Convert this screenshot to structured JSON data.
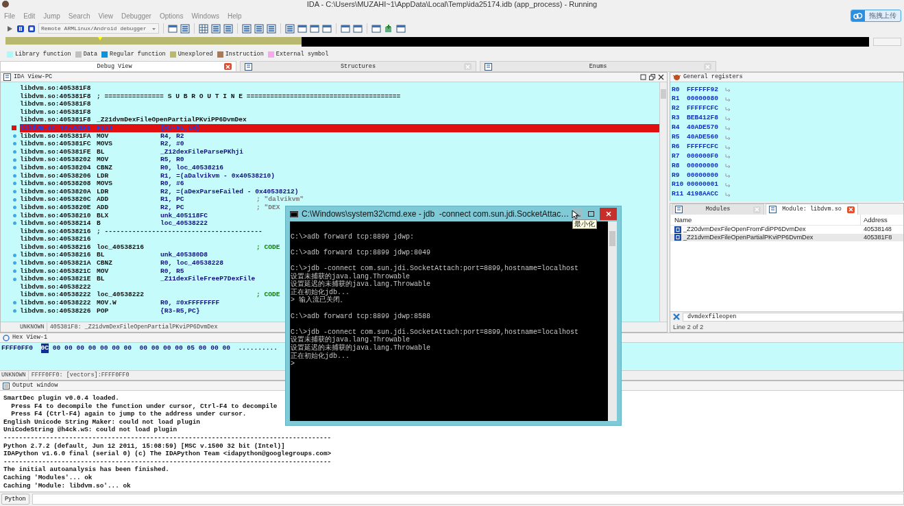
{
  "window": {
    "title": "IDA - C:\\Users\\MUZAHI~1\\AppData\\Local\\Temp\\ida25174.idb (app_process) - Running"
  },
  "menu": [
    "File",
    "Edit",
    "Jump",
    "Search",
    "View",
    "Debugger",
    "Options",
    "Windows",
    "Help"
  ],
  "upload_button": {
    "label": "拖拽上传"
  },
  "toolbar": {
    "debugger": "Remote ARMLinux/Android debugger"
  },
  "legend": [
    {
      "label": "Library function",
      "color": "#b0f8f8"
    },
    {
      "label": "Data",
      "color": "#c0c0c0"
    },
    {
      "label": "Regular function",
      "color": "#1090d8"
    },
    {
      "label": "Unexplored",
      "color": "#b8b870"
    },
    {
      "label": "Instruction",
      "color": "#b07850"
    },
    {
      "label": "External symbol",
      "color": "#f8a8f0"
    }
  ],
  "tabs": [
    {
      "label": "Debug View",
      "selected": true
    },
    {
      "label": "Structures",
      "selected": false
    },
    {
      "label": "Enums",
      "selected": false
    }
  ],
  "ida_view": {
    "title": "IDA View-PC",
    "lines": [
      {
        "addr": "libdvm.so:405381F8",
        "breakpoint": false,
        "dot": false,
        "current": false
      },
      {
        "addr": "libdvm.so:405381F8",
        "text": "; =============== S U B R O U T I N E =======================================",
        "breakpoint": false,
        "dot": false,
        "current": false
      },
      {
        "addr": "libdvm.so:405381F8",
        "breakpoint": false,
        "dot": false,
        "current": false
      },
      {
        "addr": "libdvm.so:405381F8",
        "breakpoint": false,
        "dot": false,
        "current": false
      },
      {
        "addr": "libdvm.so:405381F8",
        "text": "_Z21dvmDexFileOpenPartialPKviPP6DvmDex",
        "breakpoint": false,
        "dot": false,
        "current": false
      },
      {
        "addr": "libdvm.so:405381F8",
        "mnem": "PUSH",
        "ops": "{R3-R5,LR}",
        "breakpoint": true,
        "dot": false,
        "current": true
      },
      {
        "addr": "libdvm.so:405381FA",
        "mnem": "MOV",
        "ops": "R4, R2",
        "breakpoint": false,
        "dot": true,
        "current": false
      },
      {
        "addr": "libdvm.so:405381FC",
        "mnem": "MOVS",
        "ops": "R2, #0",
        "breakpoint": false,
        "dot": true,
        "current": false
      },
      {
        "addr": "libdvm.so:405381FE",
        "mnem": "BL",
        "ops": "_Z12dexFileParsePKhji",
        "breakpoint": false,
        "dot": true,
        "current": false
      },
      {
        "addr": "libdvm.so:40538202",
        "mnem": "MOV",
        "ops": "R5, R0",
        "breakpoint": false,
        "dot": true,
        "current": false
      },
      {
        "addr": "libdvm.so:40538204",
        "mnem": "CBNZ",
        "ops": "R0, loc_40538216",
        "breakpoint": false,
        "dot": true,
        "current": false
      },
      {
        "addr": "libdvm.so:40538206",
        "mnem": "LDR",
        "ops": "R1, =(aDalvikvm - 0x40538210)",
        "breakpoint": false,
        "dot": true,
        "current": false
      },
      {
        "addr": "libdvm.so:40538208",
        "mnem": "MOVS",
        "ops": "R0, #6",
        "breakpoint": false,
        "dot": true,
        "current": false
      },
      {
        "addr": "libdvm.so:4053820A",
        "mnem": "LDR",
        "ops": "R2, =(aDexParseFailed - 0x40538212)",
        "breakpoint": false,
        "dot": true,
        "current": false
      },
      {
        "addr": "libdvm.so:4053820C",
        "mnem": "ADD",
        "ops": "R1, PC",
        "comment": "; \"dalvikvm\"",
        "breakpoint": false,
        "dot": true,
        "current": false
      },
      {
        "addr": "libdvm.so:4053820E",
        "mnem": "ADD",
        "ops": "R2, PC",
        "comment": "; \"DEX",
        "breakpoint": false,
        "dot": true,
        "current": false
      },
      {
        "addr": "libdvm.so:40538210",
        "mnem": "BLX",
        "ops": "unk_405118FC",
        "breakpoint": false,
        "dot": true,
        "current": false
      },
      {
        "addr": "libdvm.so:40538214",
        "mnem": "B",
        "ops": "loc_40538222",
        "breakpoint": false,
        "dot": true,
        "current": false
      },
      {
        "addr": "libdvm.so:40538216",
        "text": "; ----------------------------------------",
        "breakpoint": false,
        "dot": false,
        "current": false
      },
      {
        "addr": "libdvm.so:40538216",
        "breakpoint": false,
        "dot": false,
        "current": false
      },
      {
        "addr": "libdvm.so:40538216",
        "text": "loc_40538216",
        "xref": "; CODE",
        "breakpoint": false,
        "dot": false,
        "current": false
      },
      {
        "addr": "libdvm.so:40538216",
        "mnem": "BL",
        "ops": "unk_405380D8",
        "breakpoint": false,
        "dot": true,
        "current": false
      },
      {
        "addr": "libdvm.so:4053821A",
        "mnem": "CBNZ",
        "ops": "R0, loc_40538228",
        "breakpoint": false,
        "dot": true,
        "current": false
      },
      {
        "addr": "libdvm.so:4053821C",
        "mnem": "MOV",
        "ops": "R0, R5",
        "breakpoint": false,
        "dot": true,
        "current": false
      },
      {
        "addr": "libdvm.so:4053821E",
        "mnem": "BL",
        "ops": "_Z11dexFileFreeP7DexFile",
        "breakpoint": false,
        "dot": true,
        "current": false
      },
      {
        "addr": "libdvm.so:40538222",
        "breakpoint": false,
        "dot": false,
        "current": false
      },
      {
        "addr": "libdvm.so:40538222",
        "text": "loc_40538222",
        "xref": "; CODE",
        "breakpoint": false,
        "dot": false,
        "current": false
      },
      {
        "addr": "libdvm.so:40538222",
        "mnem": "MOV.W",
        "ops": "R0, #0xFFFFFFFF",
        "breakpoint": false,
        "dot": true,
        "current": false
      },
      {
        "addr": "libdvm.so:40538226",
        "mnem": "POP",
        "ops": "{R3-R5,PC}",
        "breakpoint": false,
        "dot": true,
        "current": false
      }
    ],
    "status_kind": "UNKNOWN",
    "status": "405381F8: _Z21dvmDexFileOpenPartialPKviPP6DvmDex"
  },
  "registers": {
    "title": "General registers",
    "rows": [
      {
        "name": "R0",
        "value": "FFFFFF92"
      },
      {
        "name": "R1",
        "value": "00000080"
      },
      {
        "name": "R2",
        "value": "FFFFFCFC"
      },
      {
        "name": "R3",
        "value": "BEB412F8"
      },
      {
        "name": "R4",
        "value": "40ADE570"
      },
      {
        "name": "R5",
        "value": "40ADE560"
      },
      {
        "name": "R6",
        "value": "FFFFFCFC"
      },
      {
        "name": "R7",
        "value": "000000F0"
      },
      {
        "name": "R8",
        "value": "00000000"
      },
      {
        "name": "R9",
        "value": "00000000"
      },
      {
        "name": "R10",
        "value": "00000001"
      },
      {
        "name": "R11",
        "value": "4198AACC"
      }
    ]
  },
  "modules": {
    "tabs": [
      {
        "label": "Modules",
        "selected": false
      },
      {
        "label": "Module: libdvm.so",
        "selected": true
      }
    ],
    "columns": [
      "Name",
      "Address"
    ],
    "rows": [
      {
        "name": "_Z20dvmDexFileOpenFromFdiPP6DvmDex",
        "address": "40538148",
        "selected": false
      },
      {
        "name": "_Z21dvmDexFileOpenPartialPKviPP6DvmDex",
        "address": "405381F8",
        "selected": true
      }
    ],
    "filter": "dvmdexfileopen",
    "status": "Line 2 of 2"
  },
  "hex_view": {
    "title": "Hex View-1",
    "address": "FFFF0FF0",
    "cursor_byte": "0C",
    "bytes": "00 00 00 00 00 00 00  00 00 00 00 05 00 00 00",
    "ascii": "..........",
    "status_kind": "UNKNOWN",
    "status": "FFFF0FF0: [vectors]:FFFF0FF0"
  },
  "output": {
    "title": "Output window",
    "lines": [
      "SmartDec plugin v0.0.4 loaded.",
      "  Press F4 to decompile the function under cursor, Ctrl-F4 to decompile",
      "  Press F4 (Ctrl-F4) again to jump to the address under cursor.",
      "English Unicode String Maker: could not load plugin",
      "UniCodeString @h4ck.wS: could not load plugin",
      "-------------------------------------------------------------------------------------",
      "Python 2.7.2 (default, Jun 12 2011, 15:08:59) [MSC v.1500 32 bit (Intel)]",
      "IDAPython v1.6.0 final (serial 0) (c) The IDAPython Team <idapython@googlegroups.com>",
      "-------------------------------------------------------------------------------------",
      "The initial autoanalysis has been finished.",
      "Caching 'Modules'... ok",
      "Caching 'Module: libdvm.so'... ok"
    ]
  },
  "python": {
    "button": "Python"
  },
  "cmd": {
    "title": "C:\\Windows\\system32\\cmd.exe - jdb  -connect com.sun.jdi.SocketAttac…",
    "tooltip": "最小化",
    "blocks": [
      [
        "C:\\>adb forward tcp:8899 jdwp:"
      ],
      [
        "C:\\>adb forward tcp:8899 jdwp:8049"
      ],
      [
        "C:\\>jdb -connect com.sun.jdi.SocketAttach:port=8899,hostname=localhost",
        "设置未捕获的java.lang.Throwable",
        "设置延迟的未捕获的java.lang.Throwable",
        "正在初始化jdb...",
        "> 输入流已关闭。"
      ],
      [
        "C:\\>adb forward tcp:8899 jdwp:8588"
      ],
      [
        "C:\\>jdb -connect com.sun.jdi.SocketAttach:port=8899,hostname=localhost",
        "设置未捕获的java.lang.Throwable",
        "设置延迟的未捕获的java.lang.Throwable",
        "正在初始化jdb...",
        ">"
      ]
    ]
  }
}
